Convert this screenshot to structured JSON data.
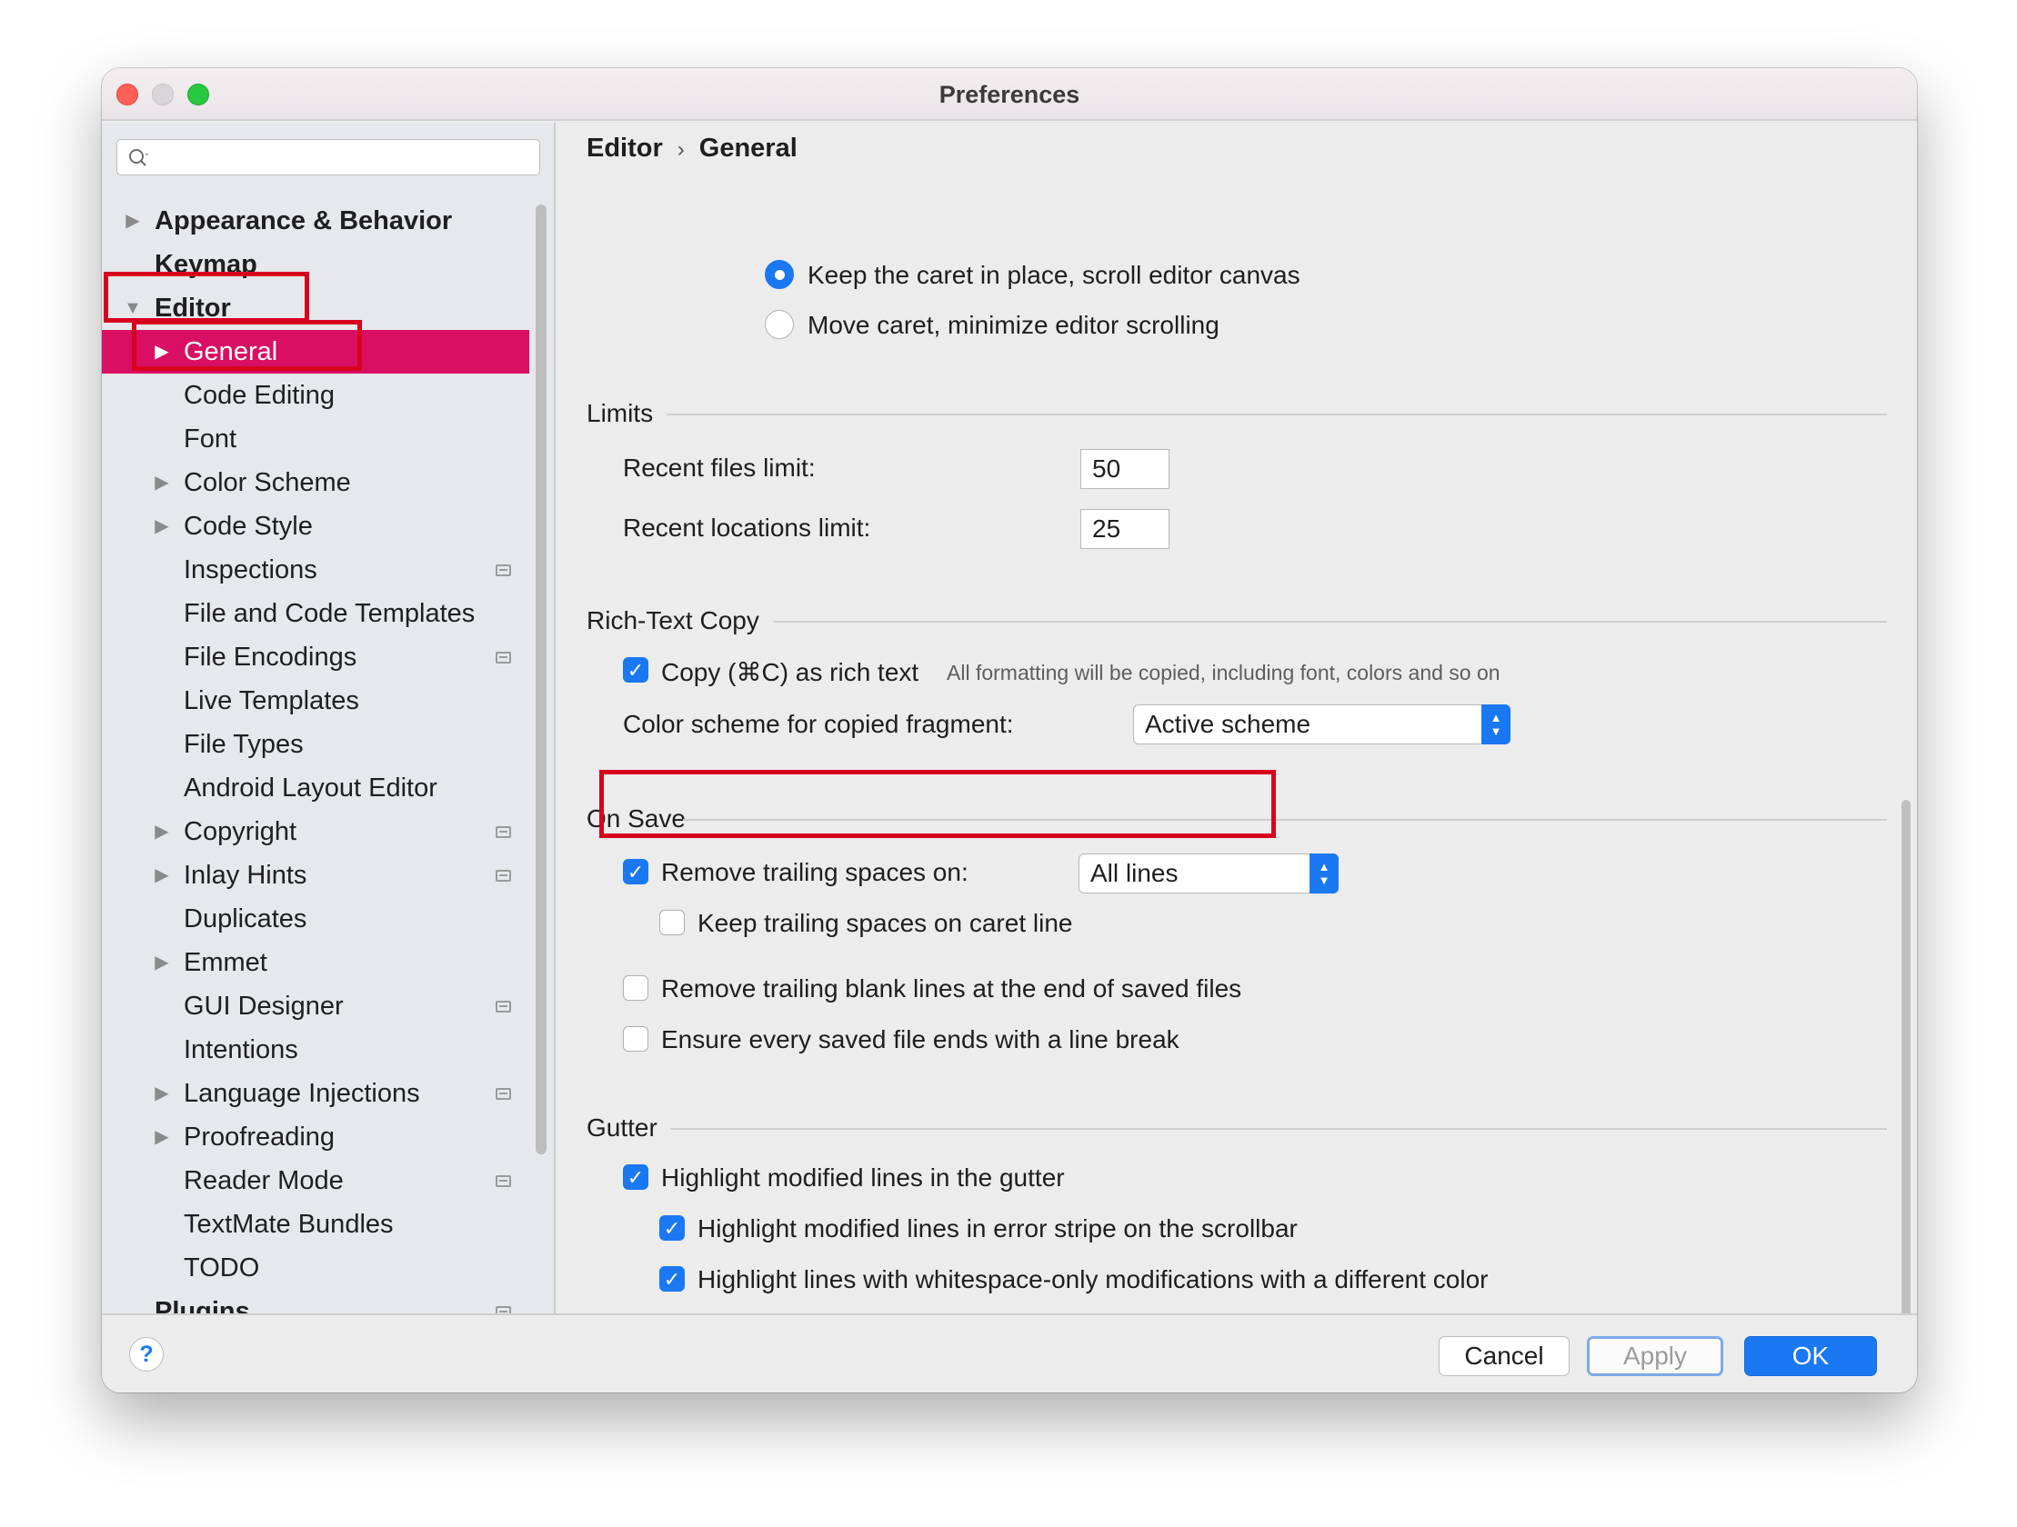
{
  "window": {
    "title": "Preferences"
  },
  "search": {
    "placeholder": ""
  },
  "sidebar": {
    "items": [
      {
        "label": "Appearance & Behavior",
        "arrow": "▶",
        "badge": false
      },
      {
        "label": "Keymap",
        "arrow": "",
        "badge": false
      },
      {
        "label": "Editor",
        "arrow": "▼",
        "badge": false
      },
      {
        "label": "General",
        "arrow": "▶",
        "badge": false,
        "selected": true
      },
      {
        "label": "Code Editing",
        "arrow": "",
        "badge": false
      },
      {
        "label": "Font",
        "arrow": "",
        "badge": false
      },
      {
        "label": "Color Scheme",
        "arrow": "▶",
        "badge": false
      },
      {
        "label": "Code Style",
        "arrow": "▶",
        "badge": false
      },
      {
        "label": "Inspections",
        "arrow": "",
        "badge": true
      },
      {
        "label": "File and Code Templates",
        "arrow": "",
        "badge": false
      },
      {
        "label": "File Encodings",
        "arrow": "",
        "badge": true
      },
      {
        "label": "Live Templates",
        "arrow": "",
        "badge": false
      },
      {
        "label": "File Types",
        "arrow": "",
        "badge": false
      },
      {
        "label": "Android Layout Editor",
        "arrow": "",
        "badge": false
      },
      {
        "label": "Copyright",
        "arrow": "▶",
        "badge": true
      },
      {
        "label": "Inlay Hints",
        "arrow": "▶",
        "badge": true
      },
      {
        "label": "Duplicates",
        "arrow": "",
        "badge": false
      },
      {
        "label": "Emmet",
        "arrow": "▶",
        "badge": false
      },
      {
        "label": "GUI Designer",
        "arrow": "",
        "badge": true
      },
      {
        "label": "Intentions",
        "arrow": "",
        "badge": false
      },
      {
        "label": "Language Injections",
        "arrow": "▶",
        "badge": true
      },
      {
        "label": "Proofreading",
        "arrow": "▶",
        "badge": false
      },
      {
        "label": "Reader Mode",
        "arrow": "",
        "badge": true
      },
      {
        "label": "TextMate Bundles",
        "arrow": "",
        "badge": false
      },
      {
        "label": "TODO",
        "arrow": "",
        "badge": false
      },
      {
        "label": "Plugins",
        "arrow": "",
        "badge": true
      }
    ]
  },
  "breadcrumb": {
    "parent": "Editor",
    "separator": "›",
    "current": "General"
  },
  "scrolling": {
    "keep_caret": "Keep the caret in place, scroll editor canvas",
    "keep_caret_selected": true,
    "move_caret": "Move caret, minimize editor scrolling",
    "move_caret_selected": false
  },
  "limits": {
    "title": "Limits",
    "recent_files_label": "Recent files limit:",
    "recent_files_value": "50",
    "recent_locations_label": "Recent locations limit:",
    "recent_locations_value": "25"
  },
  "rich_text": {
    "title": "Rich-Text Copy",
    "copy_label": "Copy (⌘C) as rich text",
    "copy_checked": true,
    "copy_note": "All formatting will be copied, including font, colors and so on",
    "scheme_label": "Color scheme for copied fragment:",
    "scheme_value": "Active scheme"
  },
  "on_save": {
    "title": "On Save",
    "remove_trailing_label": "Remove trailing spaces on:",
    "remove_trailing_checked": true,
    "remove_trailing_value": "All lines",
    "keep_trailing_label": "Keep trailing spaces on caret line",
    "keep_trailing_checked": false,
    "remove_blank_label": "Remove trailing blank lines at the end of saved files",
    "remove_blank_checked": false,
    "ensure_break_label": "Ensure every saved file ends with a line break",
    "ensure_break_checked": false
  },
  "gutter": {
    "title": "Gutter",
    "highlight_modified_label": "Highlight modified lines in the gutter",
    "highlight_modified_checked": true,
    "error_stripe_label": "Highlight modified lines in error stripe on the scrollbar",
    "error_stripe_checked": true,
    "whitespace_label": "Highlight lines with whitespace-only modifications with a different color",
    "whitespace_checked": true
  },
  "footer": {
    "help": "?",
    "cancel": "Cancel",
    "apply": "Apply",
    "ok": "OK"
  },
  "icons": {
    "check": "✓",
    "stepper": "⌃⌄"
  },
  "colors": {
    "accent": "#1a78f2",
    "selection": "#d90f63",
    "annotation": "#d8011d"
  }
}
